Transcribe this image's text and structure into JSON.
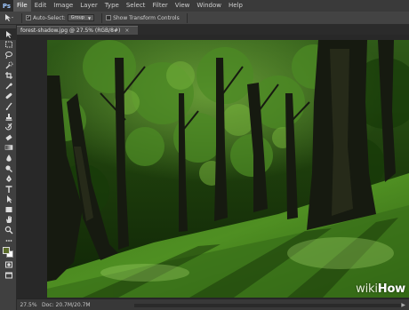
{
  "app": {
    "logo": "Ps",
    "menu": [
      "File",
      "Edit",
      "Image",
      "Layer",
      "Type",
      "Select",
      "Filter",
      "View",
      "Window",
      "Help"
    ]
  },
  "options": {
    "auto_select_label": "Auto-Select:",
    "auto_select_value": "Group",
    "show_transform_label": "Show Transform Controls"
  },
  "document": {
    "tab_title": "forest-shadow.jpg @ 27.5% (RGB/8#)",
    "close_symbol": "×"
  },
  "status": {
    "zoom": "27.5%",
    "doc_size": "Doc: 20.7M/20.7M",
    "arrow": "▶"
  },
  "watermark": {
    "wiki": "wiki",
    "how": "How"
  },
  "colors": {
    "foreground": "#5b6c2a",
    "background": "#ffffff",
    "accent": "#9fc8ff"
  },
  "tools": [
    "move-tool-icon",
    "marquee-tool-icon",
    "lasso-tool-icon",
    "quick-select-tool-icon",
    "crop-tool-icon",
    "eyedropper-tool-icon",
    "healing-brush-tool-icon",
    "brush-tool-icon",
    "clone-stamp-tool-icon",
    "history-brush-tool-icon",
    "eraser-tool-icon",
    "gradient-tool-icon",
    "blur-tool-icon",
    "dodge-tool-icon",
    "pen-tool-icon",
    "type-tool-icon",
    "path-selection-tool-icon",
    "shape-tool-icon",
    "hand-tool-icon",
    "zoom-tool-icon"
  ]
}
